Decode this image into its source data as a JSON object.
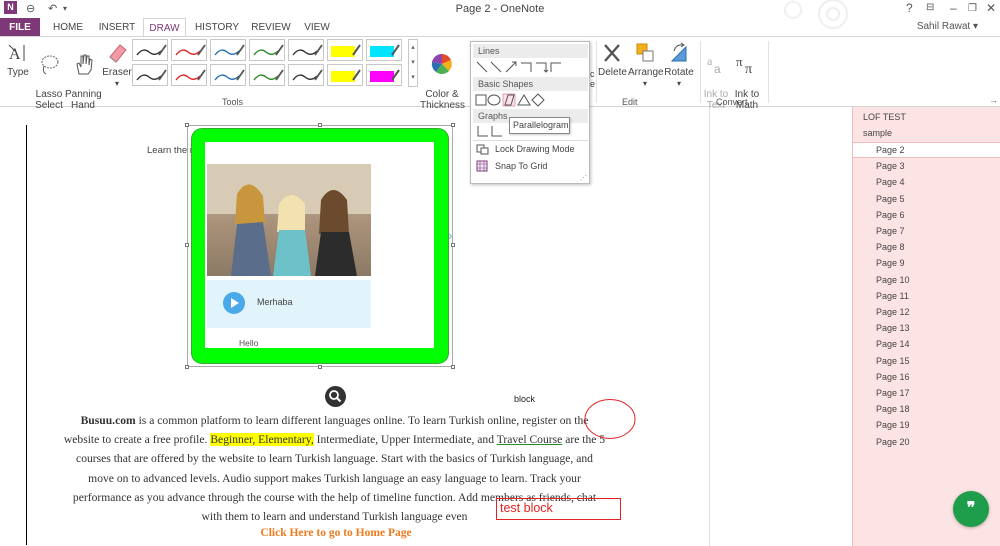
{
  "window": {
    "title": "Page 2 - OneNote",
    "user": "Sahil Rawat",
    "help": "?",
    "restore_icon": "ribbon-display-icon",
    "minimize": "–",
    "maximize": "❐",
    "close": "✕"
  },
  "tabs": [
    "FILE",
    "HOME",
    "INSERT",
    "DRAW",
    "HISTORY",
    "REVIEW",
    "VIEW"
  ],
  "ribbon": {
    "tools": {
      "type": "Type",
      "lasso": "Lasso\nSelect",
      "panning": "Panning\nHand",
      "eraser": "Eraser",
      "color_thickness": "Color &\nThickness",
      "label": "Tools"
    },
    "pen_colors": {
      "row1": [
        "#333333",
        "#e02424",
        "#2a6fb0",
        "#2a8a2a",
        "#333333",
        "#ffff00",
        "#00e5ff"
      ],
      "row2": [
        "#333333",
        "#e02424",
        "#2a6fb0",
        "#2a8a2a",
        "#333333",
        "#ffff00",
        "#ff00ff"
      ]
    },
    "edit": {
      "delete": "Delete",
      "arrange": "Arrange",
      "rotate": "Rotate",
      "label": "Edit"
    },
    "convert": {
      "ink_to_text": "Ink to\nText",
      "ink_to_math": "Ink to\nMath",
      "label": "Convert"
    }
  },
  "shapes_panel": {
    "lines": "Lines",
    "basic_shapes": "Basic Shapes",
    "graphs": "Graphs",
    "lock_drawing_mode": "Lock Drawing Mode",
    "snap_to_grid": "Snap To Grid",
    "tooltip": "Parallelogram"
  },
  "page": {
    "heading": "Learn the meaning of the phrases using the translation and audio",
    "card_word": "Merhaba",
    "card_translation": "Hello",
    "block_label": "block",
    "test_block": "test block",
    "body": {
      "brand": "Busuu.com",
      "p1": " is a common platform to learn different languages online. To learn Turkish online, register on the website to create a free profile. ",
      "highlight": "Beginner, Elementary,",
      "p2": " Intermediate, Upper Intermediate, and ",
      "underlined": "Travel Course",
      "p3": " are the 5 courses that are offered by the website to learn Turkish language. Start with the basics of Turkish language, and move on to advanced levels. Audio support makes Turkish language an easy language to learn. Track your performance as you advance through the course with the help of timeline function. Add members as friends, chat with them to learn and understand Turkish language even"
    },
    "link": "Click Here to go to Home Page"
  },
  "notebook": {
    "section": "LOF TEST",
    "subsection": "sample",
    "pages": [
      "Page 2",
      "Page 3",
      "Page 4",
      "Page 5",
      "Page 6",
      "Page 7",
      "Page 8",
      "Page 9",
      "Page 10",
      "Page 11",
      "Page 12",
      "Page 13",
      "Page 14",
      "Page 15",
      "Page 16",
      "Page 17",
      "Page 18",
      "Page 19",
      "Page 20"
    ]
  },
  "colors": {
    "accent": "#7E3878",
    "image_border": "#00ff00",
    "fab": "#1e9e4a",
    "pages_bg": "#fde4e4"
  }
}
